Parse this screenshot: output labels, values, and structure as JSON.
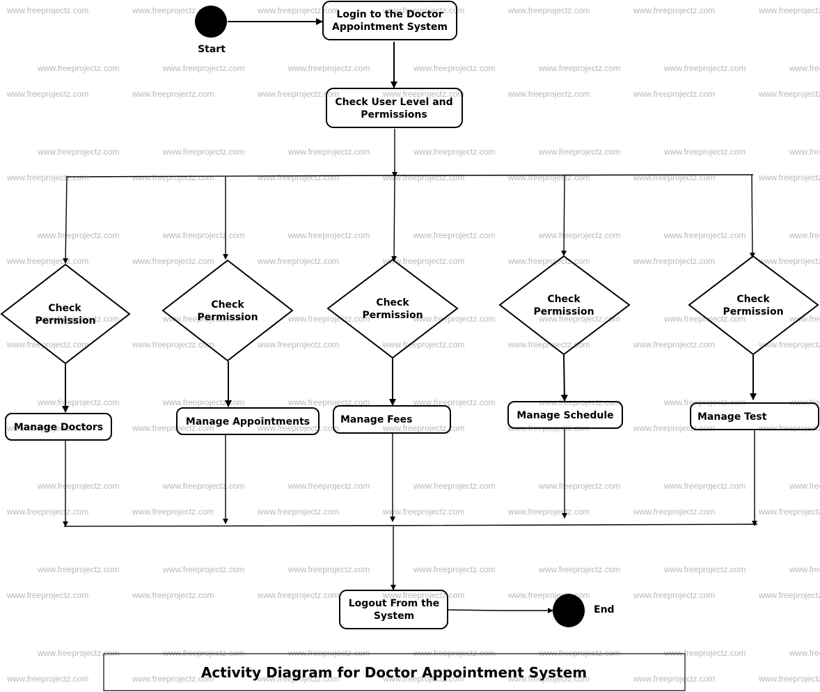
{
  "watermark": "www.freeprojectz.com",
  "start": {
    "label": "Start"
  },
  "end": {
    "label": "End"
  },
  "login": {
    "line1": "Login to the Doctor",
    "line2": "Appointment System"
  },
  "check_level": {
    "line1": "Check User Level and",
    "line2": "Permissions"
  },
  "decisions": [
    {
      "line1": "Check",
      "line2": "Permission"
    },
    {
      "line1": "Check",
      "line2": "Permission"
    },
    {
      "line1": "Check",
      "line2": "Permission"
    },
    {
      "line1": "Check",
      "line2": "Permission"
    },
    {
      "line1": "Check",
      "line2": "Permission"
    }
  ],
  "activities": [
    {
      "label": "Manage Doctors"
    },
    {
      "label": "Manage Appointments"
    },
    {
      "label": "Manage Fees"
    },
    {
      "label": "Manage Schedule"
    },
    {
      "label": "Manage Test"
    }
  ],
  "logout": {
    "line1": "Logout From the",
    "line2": "System"
  },
  "title": "Activity Diagram for Doctor Appointment System"
}
